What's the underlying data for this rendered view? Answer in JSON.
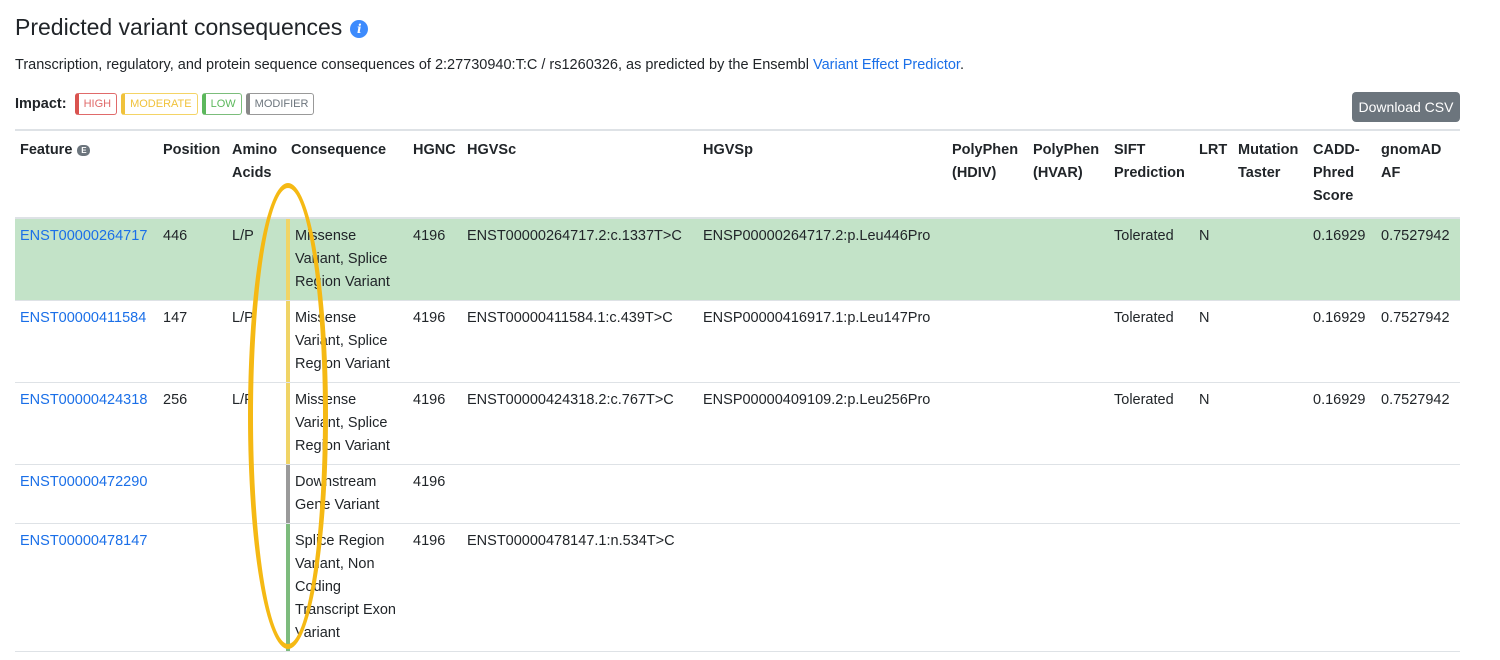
{
  "title": "Predicted variant consequences",
  "subtitle": {
    "text": "Transcription, regulatory, and protein sequence consequences of 2:27730940:T:C / rs1260326, as predicted by the Ensembl ",
    "link": "Variant Effect Predictor",
    "suffix": "."
  },
  "impact": {
    "label": "Impact:",
    "badges": [
      "HIGH",
      "MODERATE",
      "LOW",
      "MODIFIER"
    ]
  },
  "download_label": "Download CSV",
  "feature_badge": "E",
  "columns": [
    "Feature",
    "Position",
    "Amino Acids",
    "Consequence",
    "HGNC",
    "HGVSc",
    "HGVSp",
    "PolyPhen (HDIV)",
    "PolyPhen (HVAR)",
    "SIFT Prediction",
    "LRT",
    "Mutation Taster",
    "CADD-Phred Score",
    "gnomAD AF"
  ],
  "rows": [
    {
      "feature": "ENST00000264717",
      "position": "446",
      "amino": "L/P",
      "consequence": "Missense Variant, Splice Region Variant",
      "impact": "moderate",
      "hgnc": "4196",
      "hgvsc": "ENST00000264717.2:c.1337T>C",
      "hgvsp": "ENSP00000264717.2:p.Leu446Pro",
      "hdiv": "",
      "hvar": "",
      "sift": "Tolerated",
      "lrt": "N",
      "mt": "",
      "cadd": "0.16929",
      "af": "0.7527942"
    },
    {
      "feature": "ENST00000411584",
      "position": "147",
      "amino": "L/P",
      "consequence": "Missense Variant, Splice Region Variant",
      "impact": "moderate",
      "hgnc": "4196",
      "hgvsc": "ENST00000411584.1:c.439T>C",
      "hgvsp": "ENSP00000416917.1:p.Leu147Pro",
      "hdiv": "",
      "hvar": "",
      "sift": "Tolerated",
      "lrt": "N",
      "mt": "",
      "cadd": "0.16929",
      "af": "0.7527942"
    },
    {
      "feature": "ENST00000424318",
      "position": "256",
      "amino": "L/P",
      "consequence": "Missense Variant, Splice Region Variant",
      "impact": "moderate",
      "hgnc": "4196",
      "hgvsc": "ENST00000424318.2:c.767T>C",
      "hgvsp": "ENSP00000409109.2:p.Leu256Pro",
      "hdiv": "",
      "hvar": "",
      "sift": "Tolerated",
      "lrt": "N",
      "mt": "",
      "cadd": "0.16929",
      "af": "0.7527942"
    },
    {
      "feature": "ENST00000472290",
      "position": "",
      "amino": "",
      "consequence": "Downstream Gene Variant",
      "impact": "modifier",
      "hgnc": "4196",
      "hgvsc": "",
      "hgvsp": "",
      "hdiv": "",
      "hvar": "",
      "sift": "",
      "lrt": "",
      "mt": "",
      "cadd": "",
      "af": ""
    },
    {
      "feature": "ENST00000478147",
      "position": "",
      "amino": "",
      "consequence": "Splice Region Variant, Non Coding Transcript Exon Variant",
      "impact": "low",
      "hgnc": "4196",
      "hgvsc": "ENST00000478147.1:n.534T>C",
      "hgvsp": "",
      "hdiv": "",
      "hvar": "",
      "sift": "",
      "lrt": "",
      "mt": "",
      "cadd": "",
      "af": ""
    }
  ]
}
